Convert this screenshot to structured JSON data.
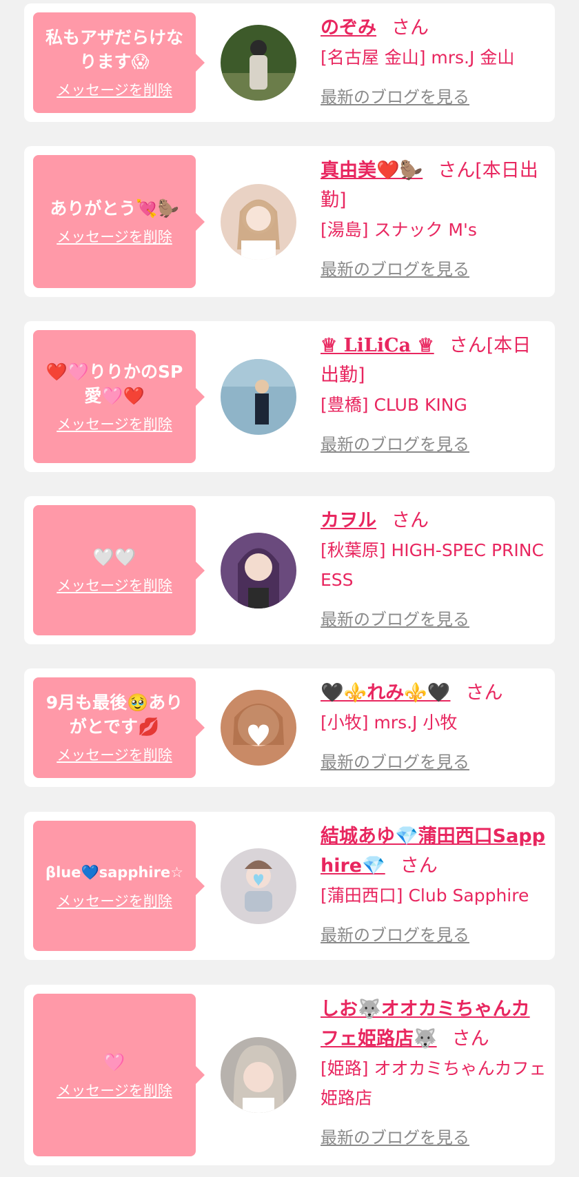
{
  "delete_label": "メッセージを削除",
  "blog_label": "最新のブログを見る",
  "san_label": "さん",
  "colors": {
    "accent": "#e8265f",
    "bubble": "#ff99a8",
    "background": "#f1f1f1",
    "link_gray": "#8a8a8a"
  },
  "cards": [
    {
      "message": "私もアザだらけなります😱",
      "name": "のぞみ",
      "status": "",
      "shop": "[名古屋 金山] mrs.J 金山"
    },
    {
      "message": "ありがとう💘🦫",
      "name": "真由美❤️🦫",
      "status": "[本日出勤]",
      "shop": "[湯島] スナック M's"
    },
    {
      "message": "❤️🩷りりかのSP愛🩷❤️",
      "name": "♕ LiLiCa ♕",
      "status": "[本日出勤]",
      "shop": "[豊橋] CLUB KING"
    },
    {
      "message": "🤍🤍",
      "name": "カヲル",
      "status": "",
      "shop": "[秋葉原] HIGH-SPEC PRINCESS"
    },
    {
      "message": "9月も最後🥹ありがとです💋",
      "name": "🖤⚜️れみ⚜️🖤",
      "status": "",
      "shop": "[小牧] mrs.J 小牧"
    },
    {
      "message": "βlue💙sapphire☆",
      "name": "結城あゆ💎蒲田西口Sapphire💎",
      "status": "",
      "shop": "[蒲田西口] Club Sapphire"
    },
    {
      "message": "🩷",
      "name": "しお🐺オオカミちゃんカフェ姫路店🐺",
      "status": "",
      "shop": "[姫路] オオカミちゃんカフェ姫路店"
    }
  ]
}
